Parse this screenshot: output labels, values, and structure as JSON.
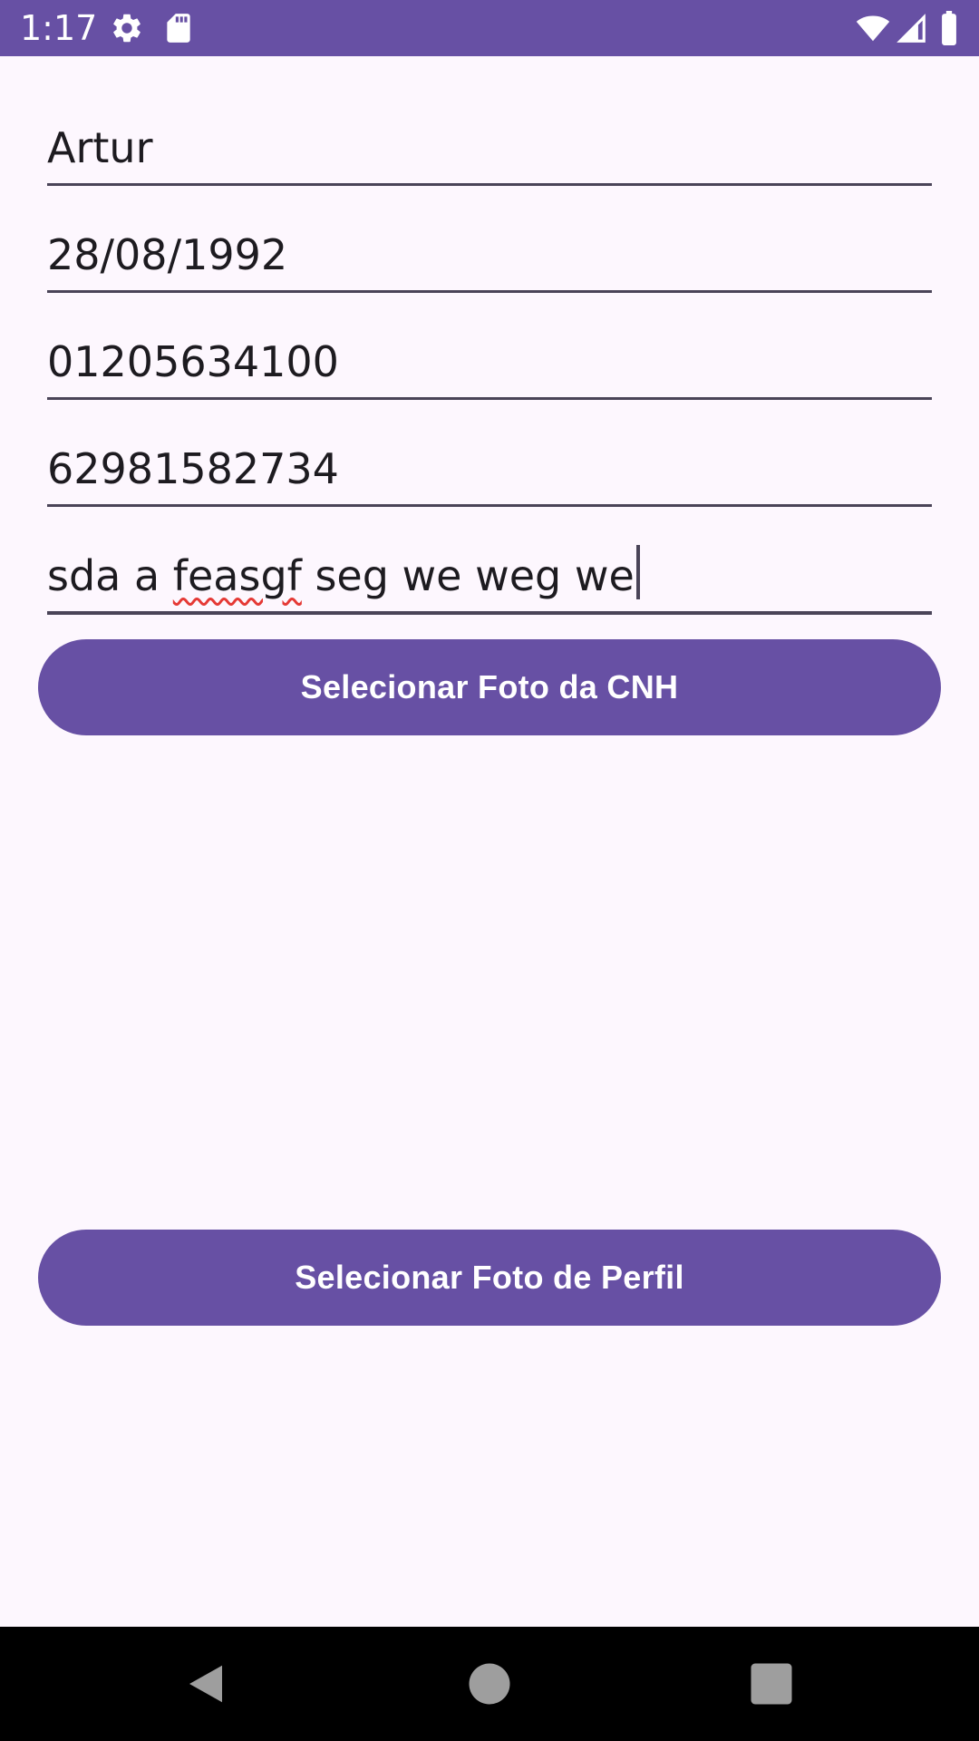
{
  "status_bar": {
    "time": "1:17",
    "icons": [
      "gear-icon",
      "sd-card-icon",
      "wifi-icon",
      "signal-icon",
      "battery-icon"
    ],
    "color": "#6750a4"
  },
  "form": {
    "fields": [
      {
        "value": "Artur"
      },
      {
        "value": "28/08/1992"
      },
      {
        "value": "01205634100"
      },
      {
        "value": "62981582734"
      },
      {
        "value_part1": "sda a ",
        "value_misspelled": "feasgf",
        "value_part2": " seg we weg we"
      }
    ]
  },
  "buttons": {
    "cnh_label": "Selecionar Foto da CNH",
    "profile_label": "Selecionar Foto de Perfil"
  },
  "colors": {
    "accent": "#6750a4",
    "background": "#fdf7fe",
    "spellcheck": "#e53935"
  },
  "nav_bar": {
    "icons": [
      "back-icon",
      "home-icon",
      "recents-icon"
    ]
  }
}
